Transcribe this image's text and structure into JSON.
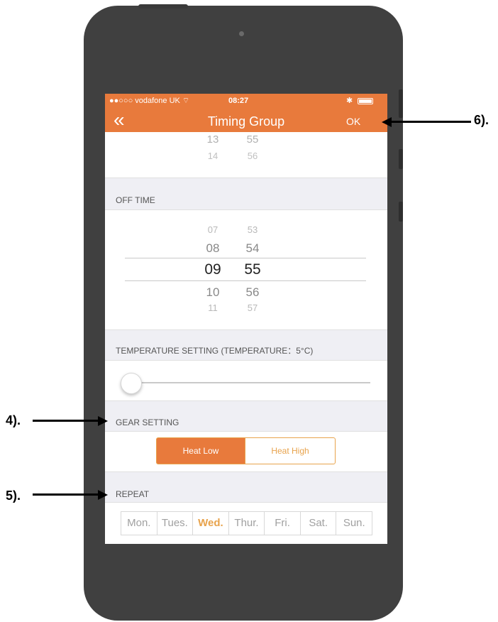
{
  "status_bar": {
    "carrier": "●●○○○ vodafone UK ⌔",
    "time": "08:27",
    "bluetooth": "✱"
  },
  "nav": {
    "back_icon": "chevron-double-left-icon",
    "back_glyph": "«",
    "title": "Timing Group",
    "ok_label": "OK"
  },
  "on_time_picker": {
    "hours": [
      "13",
      "14"
    ],
    "minutes": [
      "55",
      "56"
    ]
  },
  "off_time": {
    "header": "OFF TIME",
    "hours": [
      "07",
      "08",
      "09",
      "10",
      "11"
    ],
    "minutes": [
      "53",
      "54",
      "55",
      "56",
      "57"
    ],
    "selected_hour": "09",
    "selected_minute": "55"
  },
  "temperature": {
    "header": "TEMPERATURE SETTING (TEMPERATURE：5°C)",
    "slider_fraction": 0.0
  },
  "gear": {
    "header": "GEAR SETTING",
    "options": [
      "Heat Low",
      "Heat High"
    ],
    "selected": "Heat Low"
  },
  "repeat": {
    "header": "REPEAT",
    "days": [
      "Mon.",
      "Tues.",
      "Wed.",
      "Thur.",
      "Fri.",
      "Sat.",
      "Sun."
    ],
    "active_day": "Wed."
  },
  "annotations": {
    "label_6": "6).",
    "label_4": "4).",
    "label_5": "5)."
  },
  "colors": {
    "accent": "#e87a3c",
    "accent_light": "#e8a34c",
    "section_bg": "#efeff4",
    "phone_body": "#404040"
  }
}
